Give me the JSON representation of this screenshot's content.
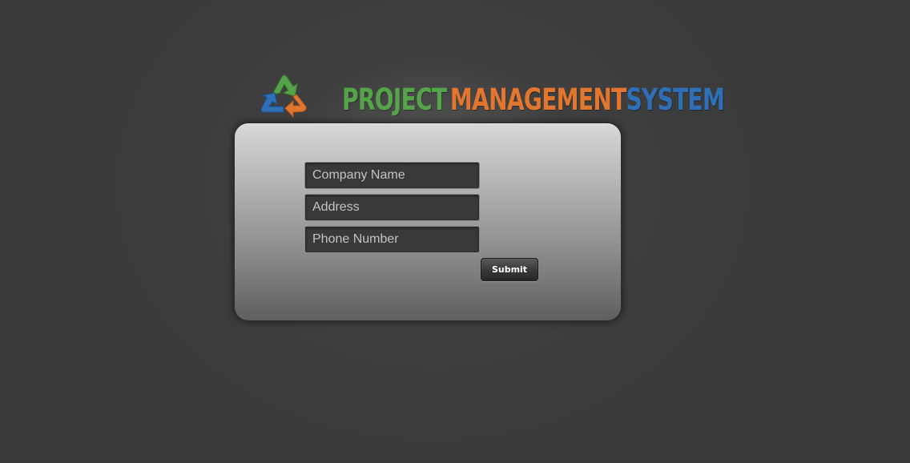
{
  "header": {
    "brand_word_1": "PROJECT",
    "brand_word_2": "MANAGEMENT",
    "brand_word_3": "SYSTEM",
    "logo_icon": "recycle-arrows-icon",
    "colors": {
      "green": "#55a44a",
      "orange": "#e2762f",
      "blue": "#2e6fb8"
    }
  },
  "form": {
    "company_name_placeholder": "Company Name",
    "address_placeholder": "Address",
    "phone_placeholder": "Phone Number",
    "submit_label": "Submit"
  }
}
